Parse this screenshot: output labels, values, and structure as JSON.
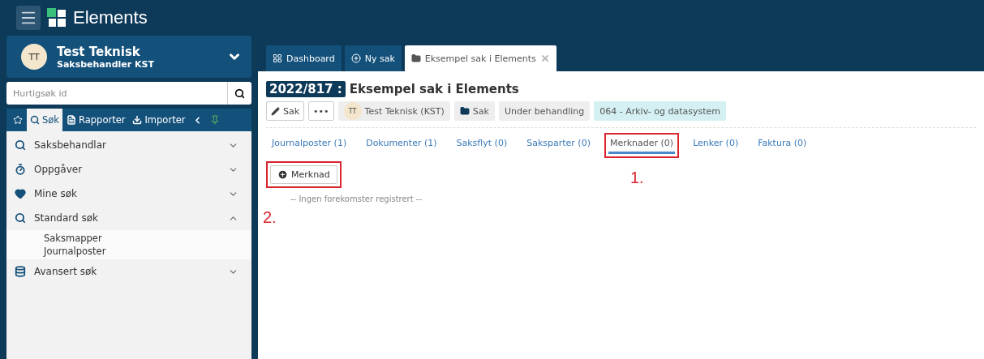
{
  "app": {
    "title": "Elements"
  },
  "user": {
    "initials": "TT",
    "name": "Test Teknisk",
    "role": "Saksbehandler KST"
  },
  "quick_search": {
    "placeholder": "Hurtigsøk id"
  },
  "sidebar_tabs": [
    {
      "label": "Søk",
      "selected": true
    },
    {
      "label": "Rapporter",
      "selected": false
    },
    {
      "label": "Importer",
      "selected": false
    }
  ],
  "sidebar_menu": [
    {
      "label": "Saksbehandlar",
      "expanded": false
    },
    {
      "label": "Oppgåver",
      "expanded": false
    },
    {
      "label": "Mine søk",
      "expanded": false
    },
    {
      "label": "Standard søk",
      "expanded": true,
      "children": [
        {
          "label": "Saksmapper"
        },
        {
          "label": "Journalposter"
        }
      ]
    },
    {
      "label": "Avansert søk",
      "expanded": false
    }
  ],
  "tabs": [
    {
      "label": "Dashboard",
      "selected": false,
      "closable": false
    },
    {
      "label": "Ny sak",
      "selected": false,
      "closable": false
    },
    {
      "label": "Eksempel sak i Elements",
      "selected": true,
      "closable": true
    }
  ],
  "case": {
    "number": "2022/817 :",
    "title": "Eksempel sak i Elements",
    "chips": [
      {
        "kind": "edit",
        "label": "Sak"
      },
      {
        "kind": "button",
        "label": "•••"
      },
      {
        "kind": "person",
        "initials": "TT",
        "label": "Test Teknisk (KST)"
      },
      {
        "kind": "folder",
        "label": "Sak"
      },
      {
        "kind": "tag",
        "label": "Under behandling"
      },
      {
        "kind": "class",
        "label": "064 - Arkiv- og datasystem"
      }
    ]
  },
  "sub_tabs": [
    {
      "label": "Journalposter (1)",
      "selected": false,
      "highlighted": false
    },
    {
      "label": "Dokumenter (1)",
      "selected": false,
      "highlighted": false
    },
    {
      "label": "Saksflyt (0)",
      "selected": false,
      "highlighted": false
    },
    {
      "label": "Saksparter (0)",
      "selected": false,
      "highlighted": false
    },
    {
      "label": "Merknader (0)",
      "selected": true,
      "highlighted": true,
      "annotation": "1."
    },
    {
      "label": "Lenker (0)",
      "selected": false,
      "highlighted": false
    },
    {
      "label": "Faktura (0)",
      "selected": false,
      "highlighted": false
    }
  ],
  "add_button": {
    "label": "Merknad",
    "highlighted": true,
    "annotation": "2."
  },
  "empty_message": "-- Ingen forekomster registrert --"
}
